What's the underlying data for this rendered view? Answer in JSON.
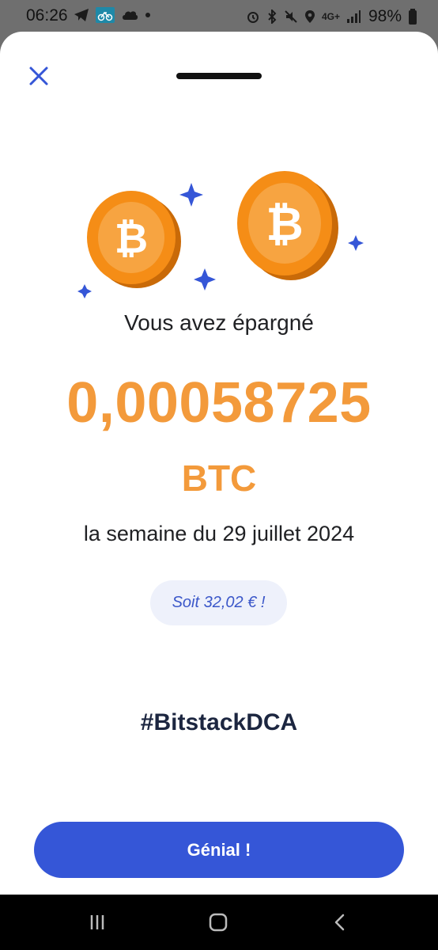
{
  "status_bar": {
    "time": "06:26",
    "battery_text": "98%",
    "network_text": "4G+",
    "left_icons": [
      "telegram-icon",
      "bike-icon",
      "cloud-icon",
      "dot-icon"
    ],
    "right_icons": [
      "alarm-icon",
      "bluetooth-icon",
      "mute-icon",
      "location-icon",
      "signal-icon",
      "battery-icon"
    ]
  },
  "sheet": {
    "close_icon": "close-icon",
    "headline": "Vous avez épargné",
    "amount": "0,00058725",
    "unit": "BTC",
    "period": "la semaine du 29 juillet 2024",
    "fiat_text": "Soit 32,02 € !",
    "hashtag": "#BitstackDCA",
    "primary_button_label": "Génial !"
  },
  "colors": {
    "accent_orange": "#f39a3b",
    "primary_blue": "#3556d7",
    "pill_bg": "#eef1fb"
  },
  "nav_bar": {
    "buttons": [
      "recents-icon",
      "home-icon",
      "back-icon"
    ]
  }
}
